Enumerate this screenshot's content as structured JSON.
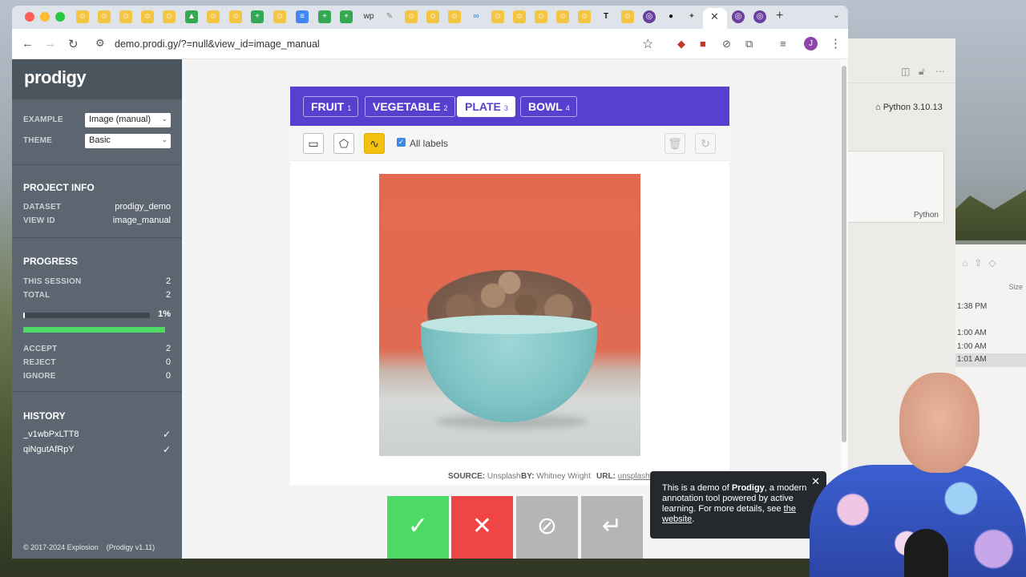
{
  "browser": {
    "url": "demo.prodi.gy/?=null&view_id=image_manual",
    "profile_initial": "J"
  },
  "app": {
    "logo": "prodigy",
    "settings": {
      "example_label": "EXAMPLE",
      "example_value": "Image (manual)",
      "theme_label": "THEME",
      "theme_value": "Basic"
    },
    "project_info": {
      "title": "PROJECT INFO",
      "dataset_label": "DATASET",
      "dataset_value": "prodigy_demo",
      "view_id_label": "VIEW ID",
      "view_id_value": "image_manual"
    },
    "progress": {
      "title": "PROGRESS",
      "this_session_label": "THIS SESSION",
      "this_session_value": "2",
      "total_label": "TOTAL",
      "total_value": "2",
      "percent": 1,
      "percent_label": "1%",
      "accept_label": "ACCEPT",
      "accept_value": "2",
      "reject_label": "REJECT",
      "reject_value": "0",
      "ignore_label": "IGNORE",
      "ignore_value": "0"
    },
    "history": {
      "title": "HISTORY",
      "items": [
        {
          "id": "_v1wbPxLTT8"
        },
        {
          "id": "qiNgutAfRpY"
        }
      ]
    },
    "footer": {
      "copyright": "© 2017-2024 Explosion",
      "version": "(Prodigy v1.11)"
    },
    "labels": [
      {
        "name": "FRUIT",
        "key": "1"
      },
      {
        "name": "VEGETABLE",
        "key": "2"
      },
      {
        "name": "PLATE",
        "key": "3"
      },
      {
        "name": "BOWL",
        "key": "4"
      }
    ],
    "active_label": "PLATE",
    "tools": {
      "all_labels": "All labels"
    },
    "meta": {
      "source_key": "SOURCE:",
      "source_value": "Unsplash",
      "by_key": "BY:",
      "by_value": "Whitney Wright",
      "url_key": "URL:",
      "url_value": "unsplash.c"
    },
    "popup": {
      "text_1": "This is a demo of ",
      "brand": "Prodigy",
      "text_2": ", a modern annotation tool powered by active learning. For more details, see ",
      "link": "the website",
      "text_3": "."
    }
  },
  "background_window": {
    "python_version": "Python 3.10.13",
    "box_label": "Python",
    "size_header": "Size",
    "times": [
      "1:38 PM",
      "",
      "1:00 AM",
      "1:00 AM",
      "1:01 AM"
    ]
  },
  "colors": {
    "accent": "#583fcf",
    "sidebar": "#5b6670",
    "accept": "#4cd964",
    "reject": "#ef4545",
    "ignore": "#b5b5b5",
    "undo": "#b5b5b5"
  }
}
